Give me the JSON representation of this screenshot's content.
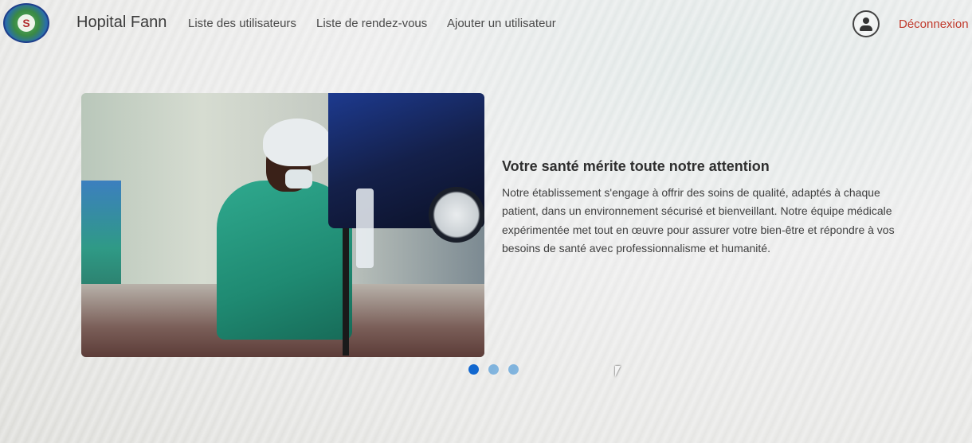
{
  "header": {
    "brand": "Hopital Fann",
    "nav": [
      {
        "label": "Liste des utilisateurs"
      },
      {
        "label": "Liste de rendez-vous"
      },
      {
        "label": "Ajouter un utilisateur"
      }
    ],
    "user_icon": "user-circle-icon",
    "logout_label": "Déconnexion",
    "logo_icon": "hospital-logo",
    "colors": {
      "logout": "#c0392b",
      "brand_text": "#3b3b3b"
    }
  },
  "carousel": {
    "slide": {
      "image": "nurse-with-iv-drip-photo",
      "title": "Votre santé mérite toute notre attention",
      "text": "Notre établissement s'engage à offrir des soins de qualité, adaptés à chaque patient, dans un environnement sécurisé et bienveillant. Notre équipe médicale expérimentée met tout en œuvre pour assurer votre bien-être et répondre à vos besoins de santé avec professionnalisme et humanité."
    },
    "indicators": {
      "count": 3,
      "active_index": 0,
      "color": "#1167cf"
    }
  }
}
